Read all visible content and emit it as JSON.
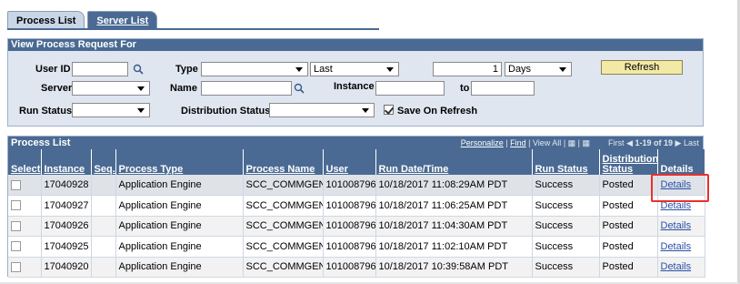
{
  "tabs": [
    {
      "label": "Process List"
    },
    {
      "label": "Server List"
    }
  ],
  "filter": {
    "title": "View Process Request For",
    "user_id_label": "User ID",
    "user_id_value": "",
    "type_label": "Type",
    "type_value": "",
    "last_value": "Last",
    "last_count": "1",
    "days_value": "Days",
    "refresh_label": "Refresh",
    "server_label": "Server",
    "server_value": "",
    "name_label": "Name",
    "name_value": "",
    "instance_label": "Instance",
    "to_label": "to",
    "run_status_label": "Run Status",
    "run_status_value": "",
    "dist_status_label": "Distribution Status",
    "dist_status_value": "",
    "save_on_refresh_label": "Save On Refresh",
    "save_on_refresh_checked": true
  },
  "grid": {
    "title": "Process List",
    "personalize": "Personalize",
    "find": "Find",
    "view_all": "View All",
    "first": "First",
    "range": "1-19 of 19",
    "last": "Last",
    "columns": [
      "Select",
      "Instance",
      "Seq.",
      "Process Type",
      "Process Name",
      "User",
      "Run Date/Time",
      "Run Status",
      "Distribution Status",
      "Details"
    ],
    "rows": [
      {
        "instance": "17040928",
        "seq": "",
        "process_type": "Application Engine",
        "process_name": "SCC_COMMGEN",
        "user": "101008796",
        "run_datetime": "10/18/2017 11:08:29AM PDT",
        "run_status": "Success",
        "dist_status": "Posted",
        "details": "Details"
      },
      {
        "instance": "17040927",
        "seq": "",
        "process_type": "Application Engine",
        "process_name": "SCC_COMMGEN",
        "user": "101008796",
        "run_datetime": "10/18/2017 11:06:25AM PDT",
        "run_status": "Success",
        "dist_status": "Posted",
        "details": "Details"
      },
      {
        "instance": "17040926",
        "seq": "",
        "process_type": "Application Engine",
        "process_name": "SCC_COMMGEN",
        "user": "101008796",
        "run_datetime": "10/18/2017 11:04:30AM PDT",
        "run_status": "Success",
        "dist_status": "Posted",
        "details": "Details"
      },
      {
        "instance": "17040925",
        "seq": "",
        "process_type": "Application Engine",
        "process_name": "SCC_COMMGEN",
        "user": "101008796",
        "run_datetime": "10/18/2017 11:02:10AM PDT",
        "run_status": "Success",
        "dist_status": "Posted",
        "details": "Details"
      },
      {
        "instance": "17040920",
        "seq": "",
        "process_type": "Application Engine",
        "process_name": "SCC_COMMGEN",
        "user": "101008796",
        "run_datetime": "10/18/2017 10:39:58AM PDT",
        "run_status": "Success",
        "dist_status": "Posted",
        "details": "Details"
      }
    ]
  },
  "colors": {
    "header_blue": "#4a6a93",
    "panel_bg": "#dfe6f0",
    "refresh_bg": "#f3e9a6",
    "highlight_box": "#e8302c",
    "link": "#2a4fa8"
  }
}
